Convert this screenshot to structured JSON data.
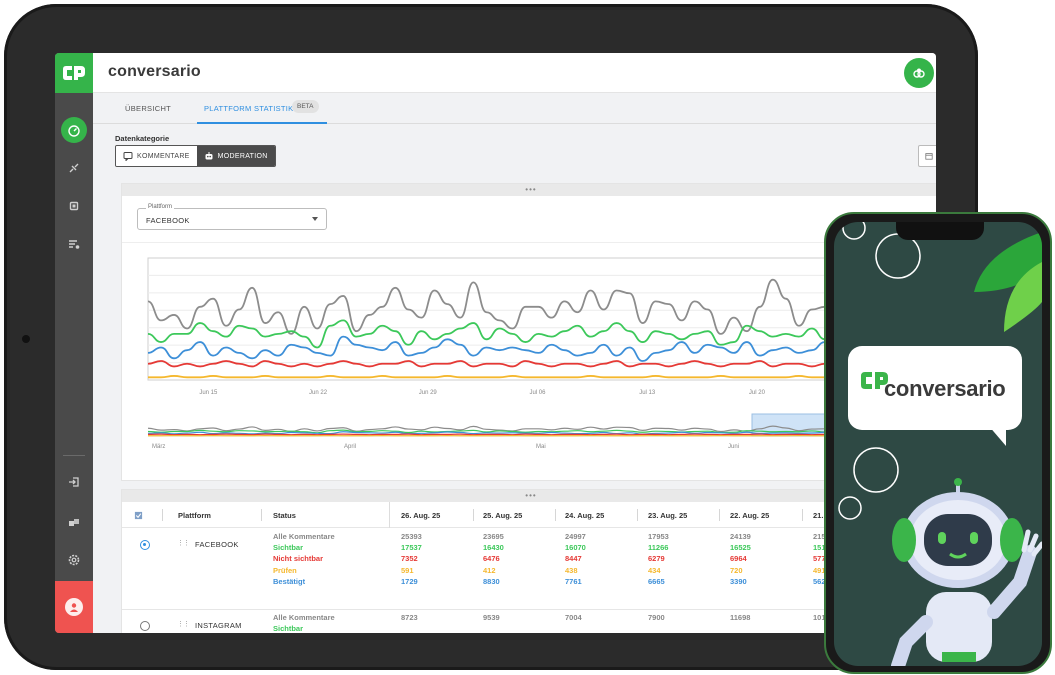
{
  "app": {
    "brand": "conversario"
  },
  "tabs": [
    {
      "label": "ÜBERSICHT"
    },
    {
      "label": "PLATTFORM STATISTIK"
    }
  ],
  "badge": "BETA",
  "category": {
    "label": "Datenkategorie",
    "options": [
      {
        "label": "KOMMENTARE"
      },
      {
        "label": "MODERATION"
      }
    ],
    "active": "MODERATION"
  },
  "platform_select": {
    "legend": "Plattform",
    "value": "FACEBOOK"
  },
  "chart_data": {
    "type": "line",
    "x": [
      "Jun 15",
      "Jun 22",
      "Jun 29",
      "Jul 06",
      "Jul 13",
      "Jul 20",
      "Jul 27"
    ],
    "navigator_labels": [
      "März",
      "April",
      "Mai",
      "Juni"
    ],
    "series": [
      {
        "color": "#8c8c8c",
        "values": [
          29,
          22,
          24,
          19,
          27,
          30,
          20,
          26,
          34,
          21,
          25,
          17,
          27,
          19,
          28,
          31,
          18,
          24,
          27,
          34,
          26,
          23,
          33,
          28,
          23,
          36,
          25,
          22,
          19,
          27,
          27,
          23,
          29,
          25,
          33,
          26,
          33,
          32,
          21,
          29,
          28,
          22,
          29,
          26,
          17,
          23,
          18,
          27,
          37,
          30,
          20,
          26,
          27,
          24,
          22,
          23,
          25,
          28,
          26,
          24
        ]
      },
      {
        "color": "#3cc85a",
        "values": [
          17,
          14,
          17,
          17,
          21,
          18,
          16,
          20,
          19,
          16,
          17,
          18,
          16,
          12,
          20,
          22,
          16,
          17,
          20,
          18,
          13,
          18,
          15,
          17,
          19,
          21,
          15,
          19,
          17,
          14,
          17,
          16,
          18,
          20,
          16,
          18,
          21,
          18,
          14,
          18,
          17,
          15,
          17,
          18,
          13,
          14,
          20,
          18,
          16,
          17,
          16,
          19,
          15,
          17,
          18,
          20,
          16,
          17,
          18,
          16
        ]
      },
      {
        "color": "#3d8fd8",
        "values": [
          10,
          12,
          8,
          11,
          14,
          9,
          12,
          10,
          8,
          11,
          9,
          13,
          12,
          10,
          9,
          16,
          13,
          12,
          11,
          14,
          9,
          10,
          12,
          15,
          13,
          9,
          12,
          11,
          12,
          11,
          10,
          13,
          11,
          9,
          10,
          13,
          9,
          12,
          7,
          10,
          11,
          14,
          10,
          13,
          12,
          10,
          14,
          9,
          11,
          12,
          10,
          11,
          14,
          12,
          13,
          9,
          11,
          10,
          12,
          13
        ]
      },
      {
        "color": "#e53935",
        "values": [
          6,
          7,
          5,
          6,
          5,
          6,
          7,
          6,
          5,
          7,
          6,
          5,
          6,
          5,
          6,
          7,
          6,
          5,
          6,
          6,
          7,
          5,
          6,
          6,
          7,
          5,
          6,
          6,
          5,
          7,
          6,
          5,
          6,
          6,
          5,
          6,
          7,
          5,
          6,
          6,
          5,
          6,
          7,
          6,
          5,
          6,
          6,
          7,
          5,
          6,
          6,
          5,
          6,
          7,
          5,
          6,
          6,
          5,
          6,
          6
        ]
      },
      {
        "color": "#f5b82e",
        "values": [
          1,
          1,
          1.5,
          1,
          1,
          1.5,
          1,
          1,
          1,
          1.5,
          1,
          1,
          1,
          1,
          1.5,
          1,
          1,
          1,
          1.5,
          1,
          1,
          1,
          1,
          1.5,
          1,
          1,
          1,
          1,
          1.5,
          1,
          1,
          1,
          1,
          1,
          1.5,
          1,
          1,
          1,
          1,
          1.5,
          1,
          1,
          1,
          1,
          1.5,
          1,
          1,
          1,
          1,
          1,
          1.5,
          1,
          1,
          1,
          1,
          1.5,
          1,
          1,
          1,
          1
        ]
      }
    ],
    "ylim": [
      0,
      45
    ],
    "grid": true
  },
  "table": {
    "headers": {
      "platform": "Plattform",
      "status": "Status"
    },
    "dates": [
      "26. Aug. 25",
      "25. Aug. 25",
      "24. Aug. 25",
      "23. Aug. 25",
      "22. Aug. 25",
      "21. A"
    ],
    "status_labels": [
      "Alle Kommentare",
      "Sichtbar",
      "Nicht sichtbar",
      "Prüfen",
      "Bestätigt"
    ],
    "status_colors": [
      "#888888",
      "#3cc85a",
      "#e53935",
      "#f5b82e",
      "#3d8fd8"
    ],
    "rows": [
      {
        "platform": "FACEBOOK",
        "selected": true,
        "values": [
          [
            "25393",
            "17537",
            "7352",
            "591",
            "1729"
          ],
          [
            "23695",
            "16430",
            "6476",
            "412",
            "8830"
          ],
          [
            "24997",
            "16070",
            "8447",
            "438",
            "7761"
          ],
          [
            "17953",
            "11266",
            "6279",
            "434",
            "6665"
          ],
          [
            "24139",
            "16525",
            "6964",
            "720",
            "3390"
          ],
          [
            "2150",
            "1518",
            "5777",
            "491",
            "5621"
          ]
        ]
      },
      {
        "platform": "INSTAGRAM",
        "selected": false,
        "values": [
          [
            "8723",
            "",
            "",
            "",
            ""
          ],
          [
            "9539",
            "",
            "",
            "",
            ""
          ],
          [
            "7004",
            "",
            "",
            "",
            ""
          ],
          [
            "7900",
            "",
            "",
            "",
            ""
          ],
          [
            "11698",
            "",
            "",
            "",
            ""
          ],
          [
            "1018",
            "",
            "",
            "",
            ""
          ]
        ]
      }
    ]
  },
  "phone": {
    "brand": "conversario"
  }
}
